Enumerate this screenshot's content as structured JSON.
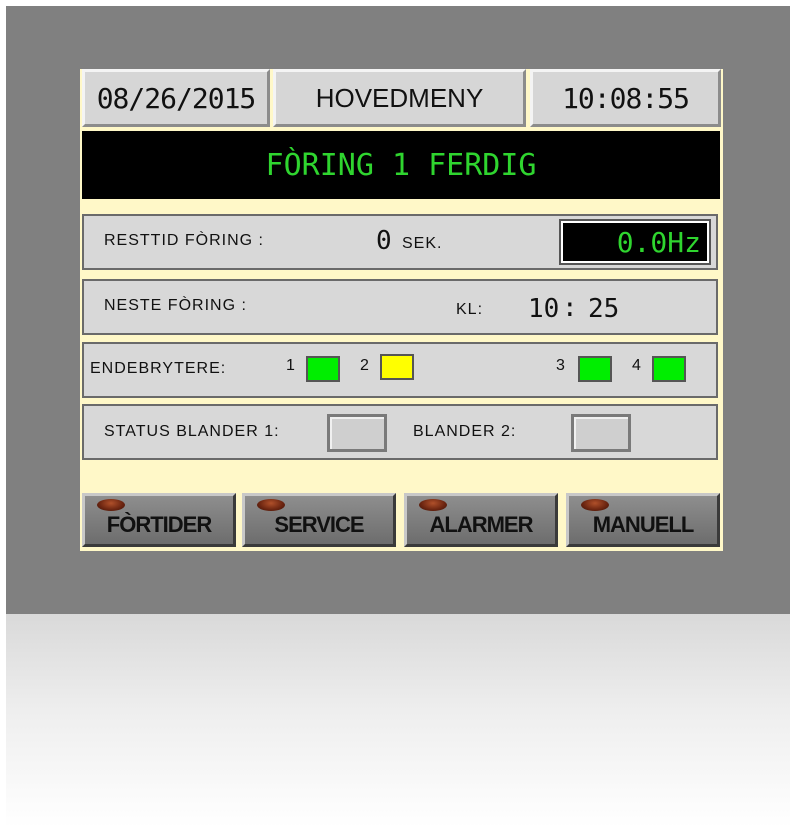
{
  "header": {
    "date": "08/26/2015",
    "menu_title": "HOVEDMENY",
    "time": "10:08:55"
  },
  "banner": {
    "message": "FÒRING 1 FERDIG"
  },
  "rest_panel": {
    "label": "RESTTID FÒRING :",
    "value": "0",
    "unit": "SEK.",
    "frequency": "0.0Hz"
  },
  "next_panel": {
    "label": "NESTE FÒRING :",
    "clock_label": "KL:",
    "hour": "10",
    "separator": ":",
    "minute": "25"
  },
  "limit_switches": {
    "label": "ENDEBRYTERE:",
    "items": [
      {
        "num": "1",
        "color": "#00ee00"
      },
      {
        "num": "2",
        "color": "#ffff00"
      },
      {
        "num": "3",
        "color": "#00ee00"
      },
      {
        "num": "4",
        "color": "#00ee00"
      }
    ]
  },
  "status_panel": {
    "blender1_label": "STATUS BLANDER 1:",
    "blender2_label": "BLANDER 2:"
  },
  "function_buttons": [
    "FÒRTIDER",
    "SERVICE",
    "ALARMER",
    "MANUELL"
  ],
  "colors": {
    "screen_bg": "#fff8c8",
    "green_text": "#2fd52f",
    "lamp_green": "#00ee00",
    "lamp_yellow": "#ffff00"
  }
}
